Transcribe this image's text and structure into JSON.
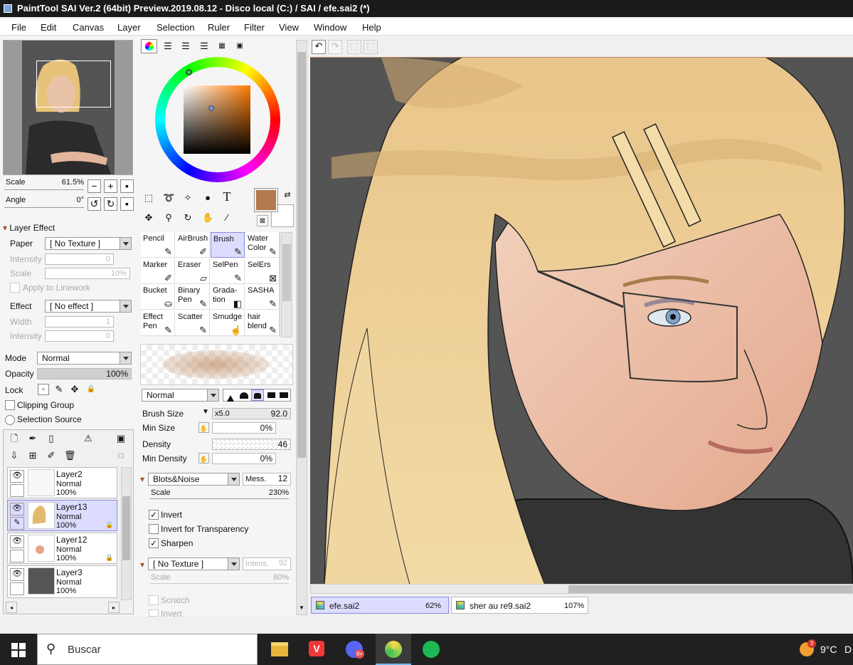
{
  "window": {
    "title": "PaintTool SAI Ver.2 (64bit) Preview.2019.08.12 - Disco local (C:) / SAI / efe.sai2 (*)"
  },
  "menu": [
    "File",
    "Edit",
    "Canvas",
    "Layer",
    "Selection",
    "Ruler",
    "Filter",
    "View",
    "Window",
    "Help"
  ],
  "navigator": {
    "scale_label": "Scale",
    "scale_value": "61.5%",
    "angle_label": "Angle",
    "angle_value": "0°"
  },
  "layer_effect": {
    "header": "Layer Effect",
    "paper_label": "Paper",
    "paper_value": "[ No Texture ]",
    "intensity_label": "Intensity",
    "intensity_value": "0",
    "scale_label": "Scale",
    "scale_value": "10%",
    "apply_linework": "Apply to Linework",
    "effect_label": "Effect",
    "effect_value": "[ No effect ]",
    "width_label": "Width",
    "width_value": "1",
    "intensity2_label": "Intensity",
    "intensity2_value": "0"
  },
  "layer_props": {
    "mode_label": "Mode",
    "mode_value": "Normal",
    "opacity_label": "Opacity",
    "opacity_value": "100%",
    "lock_label": "Lock",
    "clipping_group": "Clipping Group",
    "selection_source": "Selection Source"
  },
  "layers": [
    {
      "name": "Layer2",
      "mode": "Normal",
      "opacity": "100%",
      "active": false
    },
    {
      "name": "Layer13",
      "mode": "Normal",
      "opacity": "100%",
      "active": true
    },
    {
      "name": "Layer12",
      "mode": "Normal",
      "opacity": "100%",
      "active": false
    },
    {
      "name": "Layer3",
      "mode": "Normal",
      "opacity": "100%",
      "active": false
    }
  ],
  "color": {
    "primary": "#b27a4e",
    "secondary": "#ffffff",
    "accent": "#8a8ae0"
  },
  "tools": [
    {
      "l1": "Pencil",
      "l2": ""
    },
    {
      "l1": "AirBrush",
      "l2": ""
    },
    {
      "l1": "Brush",
      "l2": ""
    },
    {
      "l1": "Water",
      "l2": "Color"
    },
    {
      "l1": "Marker",
      "l2": ""
    },
    {
      "l1": "Eraser",
      "l2": ""
    },
    {
      "l1": "SelPen",
      "l2": ""
    },
    {
      "l1": "SelErs",
      "l2": ""
    },
    {
      "l1": "Bucket",
      "l2": ""
    },
    {
      "l1": "Binary",
      "l2": "Pen"
    },
    {
      "l1": "Grada-",
      "l2": "tion"
    },
    {
      "l1": "SASHA",
      "l2": ""
    },
    {
      "l1": "Effect",
      "l2": "Pen"
    },
    {
      "l1": "Scatter",
      "l2": ""
    },
    {
      "l1": "Smudge",
      "l2": ""
    },
    {
      "l1": "hair",
      "l2": "blend"
    }
  ],
  "brush": {
    "mode_value": "Normal",
    "size_label": "Brush Size",
    "size_mult": "x5.0",
    "size_value": "92.0",
    "min_size_label": "Min Size",
    "min_size_value": "0%",
    "density_label": "Density",
    "density_value": "46",
    "min_density_label": "Min Density",
    "min_density_value": "0%",
    "texture_value": "Blots&Noise",
    "mess_label": "Mess.",
    "mess_value": "12",
    "tex_scale_label": "Scale",
    "tex_scale_value": "230%",
    "invert": "Invert",
    "invert_transparency": "Invert for Transparency",
    "sharpen": "Sharpen",
    "no_texture": "[ No Texture ]",
    "intens_label": "Intens.",
    "intens_value": "92",
    "scale2_label": "Scale",
    "scale2_value": "80%",
    "scratch": "Scratch",
    "invert2": "Invert"
  },
  "doc_tabs": [
    {
      "name": "efe.sai2",
      "zoom": "62%"
    },
    {
      "name": "sher au re9.sai2",
      "zoom": "107%"
    }
  ],
  "taskbar": {
    "search": "Buscar",
    "temp": "9°C",
    "extra": "D",
    "notif": "3"
  }
}
